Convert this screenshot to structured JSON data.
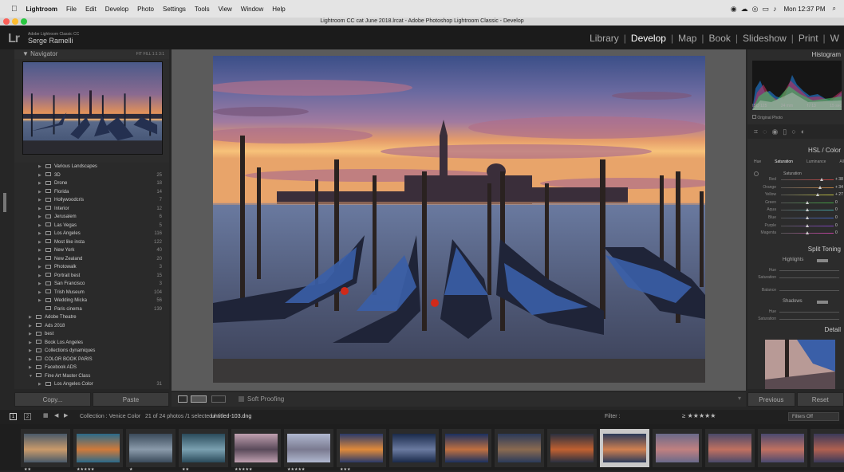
{
  "menubar": {
    "apple": "",
    "items": [
      "Lightroom",
      "File",
      "Edit",
      "Develop",
      "Photo",
      "Settings",
      "Tools",
      "View",
      "Window",
      "Help"
    ],
    "clock": "Mon 12:37 PM"
  },
  "window": {
    "title": "Lightroom CC cat June 2018.lrcat - Adobe Photoshop Lightroom Classic - Develop"
  },
  "identity": {
    "logo": "Lr",
    "catalog": "Adobe Lightroom Classic CC",
    "user": "Serge Ramelli"
  },
  "modules": [
    "Library",
    "Develop",
    "Map",
    "Book",
    "Slideshow",
    "Print",
    "W"
  ],
  "active_module": "Develop",
  "navigator": {
    "title": "Navigator",
    "zoom": "FIT  FILL  1:1  3:1"
  },
  "folders": [
    {
      "name": "Various Landscapes",
      "count": "",
      "indent": 2,
      "tri": "▶"
    },
    {
      "name": "3D",
      "count": "25",
      "indent": 2,
      "tri": "▶"
    },
    {
      "name": "Drone",
      "count": "18",
      "indent": 2,
      "tri": "▶"
    },
    {
      "name": "Florida",
      "count": "14",
      "indent": 2,
      "tri": "▶"
    },
    {
      "name": "Hollywoodcris",
      "count": "7",
      "indent": 2,
      "tri": "▶"
    },
    {
      "name": "Interior",
      "count": "12",
      "indent": 2,
      "tri": "▶"
    },
    {
      "name": "Jerusalem",
      "count": "6",
      "indent": 2,
      "tri": "▶"
    },
    {
      "name": "Las Vegas",
      "count": "5",
      "indent": 2,
      "tri": "▶"
    },
    {
      "name": "Los Angeles",
      "count": "116",
      "indent": 2,
      "tri": "▶"
    },
    {
      "name": "Most like insta",
      "count": "122",
      "indent": 2,
      "tri": "▶"
    },
    {
      "name": "New York",
      "count": "40",
      "indent": 2,
      "tri": "▶"
    },
    {
      "name": "New Zealand",
      "count": "20",
      "indent": 2,
      "tri": "▶"
    },
    {
      "name": "Photowalk",
      "count": "3",
      "indent": 2,
      "tri": "▶"
    },
    {
      "name": "Portrait best",
      "count": "15",
      "indent": 2,
      "tri": "▶"
    },
    {
      "name": "San Francisco",
      "count": "3",
      "indent": 2,
      "tri": "▶"
    },
    {
      "name": "Trish Museum",
      "count": "104",
      "indent": 2,
      "tri": "▶"
    },
    {
      "name": "Wedding Micka",
      "count": "56",
      "indent": 2,
      "tri": "▶"
    },
    {
      "name": "Paris cinema",
      "count": "139",
      "indent": 2,
      "tri": ""
    },
    {
      "name": "Adobe Theatre",
      "count": "",
      "indent": 1,
      "tri": "▶"
    },
    {
      "name": "Ads 2018",
      "count": "",
      "indent": 1,
      "tri": "▶"
    },
    {
      "name": "best",
      "count": "",
      "indent": 1,
      "tri": "▶"
    },
    {
      "name": "Book Los Angeles",
      "count": "",
      "indent": 1,
      "tri": "▶"
    },
    {
      "name": "Collections dynamiques",
      "count": "",
      "indent": 1,
      "tri": "▶"
    },
    {
      "name": "COLOR BOOK PARIS",
      "count": "",
      "indent": 1,
      "tri": "▶"
    },
    {
      "name": "Facebook ADS",
      "count": "",
      "indent": 1,
      "tri": "▶"
    },
    {
      "name": "Fine Art Master Class",
      "count": "",
      "indent": 1,
      "tri": "▼"
    },
    {
      "name": "Los Angeles Color",
      "count": "31",
      "indent": 2,
      "tri": "▶"
    }
  ],
  "left_buttons": {
    "copy": "Copy...",
    "paste": "Paste"
  },
  "toolbar": {
    "soft_proofing": "Soft Proofing"
  },
  "right_panel": {
    "histogram": "Histogram",
    "exif": [
      "ISO 125",
      "24 mm",
      "f / 13",
      "15 sec"
    ],
    "original": "Original Photo",
    "hsl_title": "HSL / Color",
    "hsl_tabs": [
      "Hue",
      "Saturation",
      "Luminance",
      "All"
    ],
    "sat_label": "Saturation",
    "colors": [
      {
        "name": "Red",
        "val": "+ 38"
      },
      {
        "name": "Orange",
        "val": "+ 34"
      },
      {
        "name": "Yellow",
        "val": "+ 27"
      },
      {
        "name": "Green",
        "val": "0"
      },
      {
        "name": "Aqua",
        "val": "0"
      },
      {
        "name": "Blue",
        "val": "0"
      },
      {
        "name": "Purple",
        "val": "0"
      },
      {
        "name": "Magenta",
        "val": "0"
      }
    ],
    "split_title": "Split Toning",
    "highlights": "Highlights",
    "shadows": "Shadows",
    "hue": "Hue",
    "saturation": "Saturation",
    "balance": "Balance",
    "detail": "Detail"
  },
  "right_buttons": {
    "previous": "Previous",
    "reset": "Reset"
  },
  "filmstrip_bar": {
    "pages": [
      "1",
      "2"
    ],
    "collection": "Collection : Venice Color",
    "info": "21 of 24 photos /1 selected /",
    "file": "untitled-103.dng",
    "filter_label": "Filter :",
    "filters_off": "Filters Off"
  },
  "filmstrip": [
    {
      "stars": "★★",
      "colors": [
        "#4a5a6a",
        "#c99a6a"
      ]
    },
    {
      "stars": "★★★★★",
      "colors": [
        "#2a6a8a",
        "#d07a3a"
      ]
    },
    {
      "stars": "★",
      "colors": [
        "#3a4a5a",
        "#8a9aaa"
      ]
    },
    {
      "stars": "★★",
      "colors": [
        "#2a4a5a",
        "#7aa0b0"
      ]
    },
    {
      "stars": "★★★★★",
      "colors": [
        "#c0a0b0",
        "#5a4a5a"
      ]
    },
    {
      "stars": "★★★★★",
      "colors": [
        "#b0b8d0",
        "#7a7a90"
      ]
    },
    {
      "stars": "★★★",
      "colors": [
        "#2a3a6a",
        "#e08a3a"
      ]
    },
    {
      "stars": "",
      "colors": [
        "#1a2a4a",
        "#6a7aa0"
      ]
    },
    {
      "stars": "",
      "colors": [
        "#1a3060",
        "#c07040"
      ]
    },
    {
      "stars": "",
      "colors": [
        "#2a3a5a",
        "#8a6a50"
      ]
    },
    {
      "stars": "",
      "colors": [
        "#2a3040",
        "#c06030"
      ]
    },
    {
      "stars": "",
      "colors": [
        "#2a3a5a",
        "#d08050"
      ],
      "selected": true
    },
    {
      "stars": "",
      "colors": [
        "#6a6a8a",
        "#c08080"
      ]
    },
    {
      "stars": "",
      "colors": [
        "#4a4a6a",
        "#c07060"
      ]
    },
    {
      "stars": "",
      "colors": [
        "#4a4a70",
        "#c07060"
      ]
    },
    {
      "stars": "",
      "colors": [
        "#3a3a5a",
        "#b06050"
      ]
    }
  ]
}
